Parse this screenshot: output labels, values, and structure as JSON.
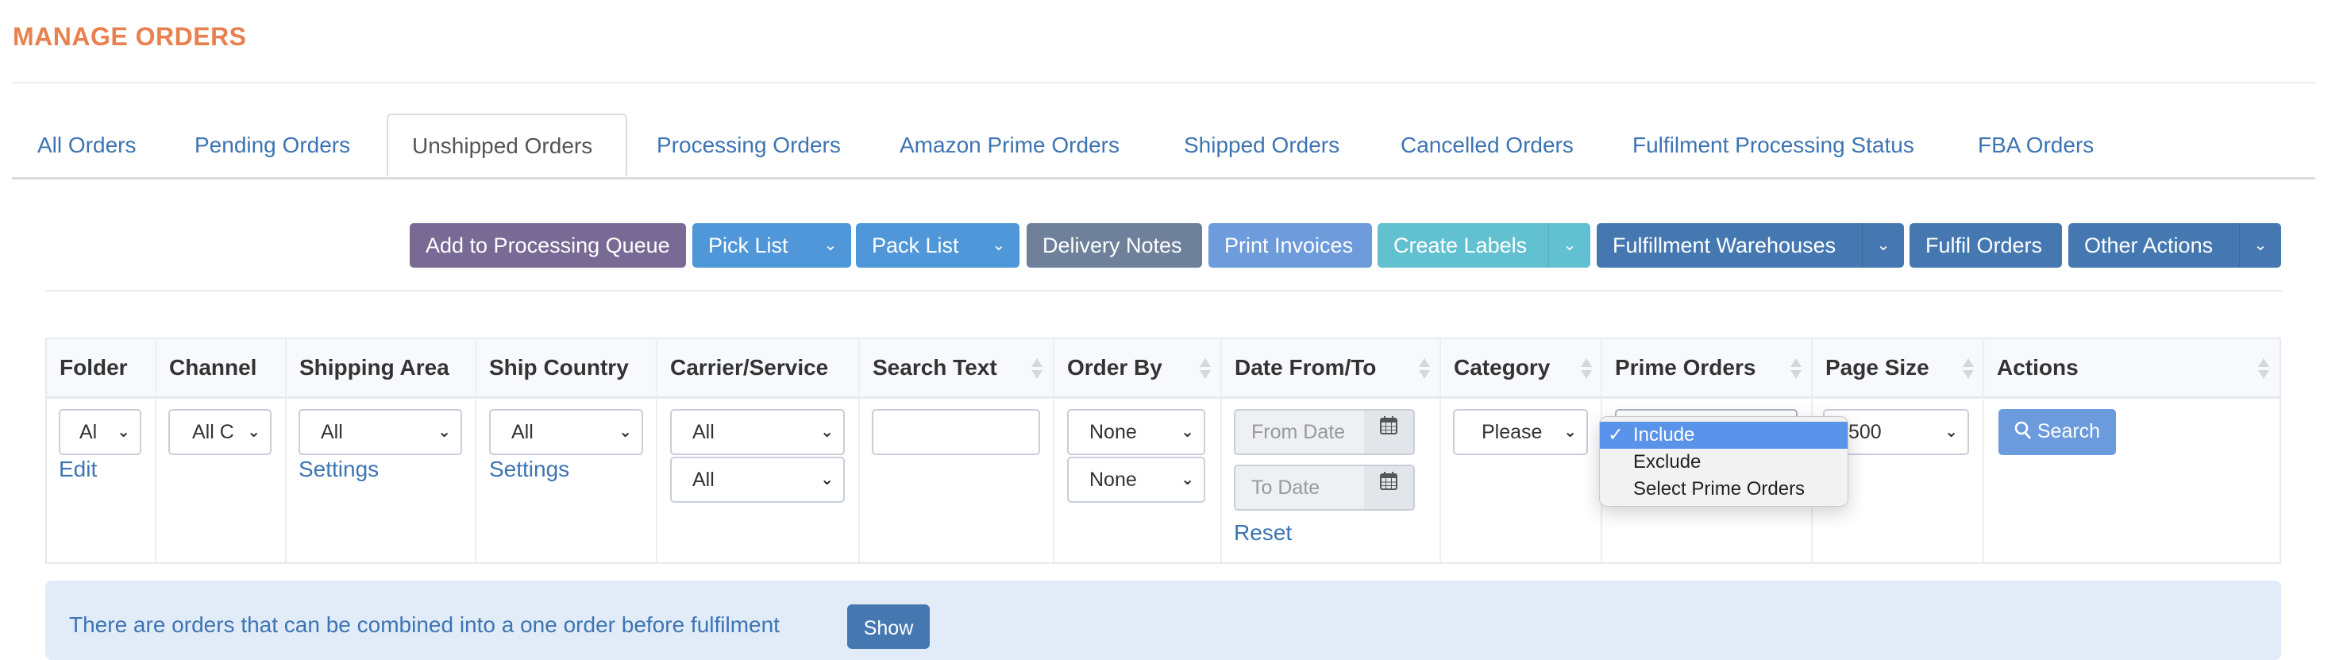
{
  "page": {
    "title": "MANAGE ORDERS"
  },
  "tabs": [
    {
      "label": "All Orders",
      "active": false
    },
    {
      "label": "Pending Orders",
      "active": false
    },
    {
      "label": "Unshipped Orders",
      "active": true
    },
    {
      "label": "Processing Orders",
      "active": false
    },
    {
      "label": "Amazon Prime Orders",
      "active": false
    },
    {
      "label": "Shipped Orders",
      "active": false
    },
    {
      "label": "Cancelled Orders",
      "active": false
    },
    {
      "label": "Fulfilment Processing Status",
      "active": false
    },
    {
      "label": "FBA Orders",
      "active": false
    }
  ],
  "toolbar": {
    "add_to_queue": "Add to Processing Queue",
    "pick_list": "Pick List",
    "pack_list": "Pack List",
    "delivery_notes": "Delivery Notes",
    "print_invoices": "Print Invoices",
    "create_labels": "Create Labels",
    "fulfillment_warehouses": "Fulfillment Warehouses",
    "fulfil_orders": "Fulfil Orders",
    "other_actions": "Other Actions",
    "caret": "⌄"
  },
  "colors": {
    "title": "#e8804f",
    "link": "#3d74b3",
    "purple_btn": "#786a95",
    "blue_btn": "#4f97d8",
    "gray_btn": "#6e809a",
    "light_blue_btn": "#6d9bdb",
    "teal_btn": "#61c1d0",
    "dark_blue_btn": "#4578b1"
  },
  "filters": {
    "headers": [
      "Folder",
      "Channel",
      "Shipping Area",
      "Ship Country",
      "Carrier/Service",
      "Search Text",
      "Order By",
      "Date From/To",
      "Category",
      "Prime Orders",
      "Page Size",
      "Actions"
    ],
    "folder": {
      "value": "Al",
      "link": "Edit"
    },
    "channel": {
      "value": "All C"
    },
    "shipping_area": {
      "value": "All",
      "link": "Settings"
    },
    "ship_country": {
      "value": "All",
      "link": "Settings"
    },
    "carrier": {
      "value": "All"
    },
    "service": {
      "value": "All"
    },
    "search_text": {
      "value": "",
      "placeholder": ""
    },
    "order_by_1": {
      "value": "None"
    },
    "order_by_2": {
      "value": "None"
    },
    "date_from": {
      "placeholder": "From Date"
    },
    "date_to": {
      "placeholder": "To Date"
    },
    "date_reset": "Reset",
    "category": {
      "value": "Please"
    },
    "page_size": {
      "value": "500"
    },
    "search_button": "Search",
    "chevron": "⌄"
  },
  "prime_dropdown": {
    "options": [
      {
        "label": "Include",
        "selected": true
      },
      {
        "label": "Exclude",
        "selected": false
      },
      {
        "label": "Select Prime Orders",
        "selected": false
      }
    ],
    "check": "✓"
  },
  "alert": {
    "text": "There are orders that can be combined into a one order before fulfilment",
    "button": "Show"
  }
}
